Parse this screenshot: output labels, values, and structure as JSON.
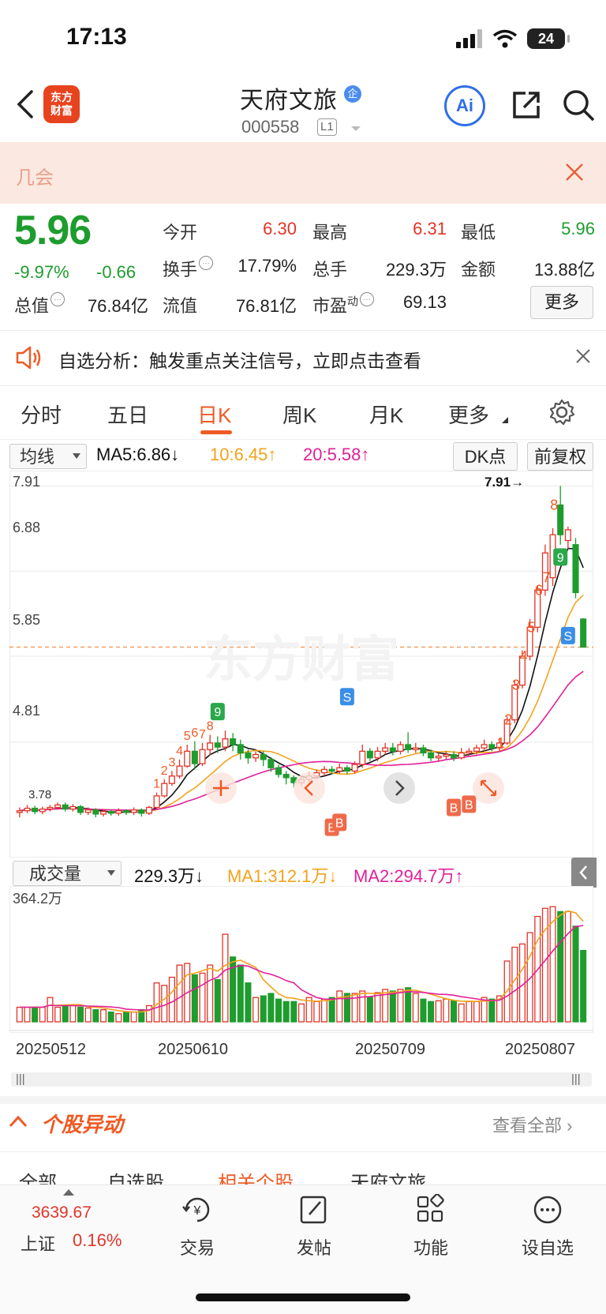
{
  "status": {
    "time": "17:13",
    "battery": "24"
  },
  "header": {
    "name": "天府文旅",
    "badge": "企",
    "code": "000558",
    "level": "L1",
    "ai": "Ai",
    "logo_line1": "东方",
    "logo_line2": "财富"
  },
  "promo": {
    "text": "几会"
  },
  "quote": {
    "price": "5.96",
    "pct": "-9.97%",
    "change": "-0.66",
    "labels": {
      "open": "今开",
      "high": "最高",
      "low": "最低",
      "turnover": "换手",
      "volume": "总手",
      "amount": "金额",
      "mcap": "总值",
      "float": "流值",
      "pe": "市盈",
      "pe_sup": "动"
    },
    "values": {
      "open": "6.30",
      "high": "6.31",
      "low": "5.96",
      "turnover": "17.79%",
      "volume": "229.3万",
      "amount": "13.88亿",
      "mcap": "76.84亿",
      "float": "76.81亿",
      "pe": "69.13"
    },
    "more": "更多"
  },
  "analysis": {
    "text": "自选分析：触发重点关注信号，立即点击查看"
  },
  "tabs": [
    "分时",
    "五日",
    "日K",
    "周K",
    "月K",
    "更多"
  ],
  "ma": {
    "select": "均线",
    "ma5": "MA5:6.86↓",
    "ma10": "10:6.45↑",
    "ma20": "20:5.58↑",
    "dk": "DK点",
    "fq": "前复权",
    "colors": {
      "ma5": "#111111",
      "ma10": "#f2a31c",
      "ma20": "#e0209a"
    }
  },
  "kline": {
    "y_labels": [
      "7.91",
      "6.88",
      "5.85",
      "4.81"
    ],
    "max_label": "7.91→",
    "min_label": "3.78",
    "watermark": "东方财富"
  },
  "volume": {
    "select": "成交量",
    "value": "229.3万↓",
    "ma1": "MA1:312.1万↓",
    "ma2": "MA2:294.7万↑",
    "max_label": "364.2万"
  },
  "dates": [
    "20250512",
    "20250610",
    "20250709",
    "20250807"
  ],
  "chart_data": {
    "type": "candlestick",
    "ylim": [
      3.7,
      8.0
    ],
    "candles": [
      [
        3.96,
        3.98,
        3.9,
        4.02
      ],
      [
        3.98,
        4.01,
        3.95,
        4.05
      ],
      [
        4.01,
        3.97,
        3.94,
        4.04
      ],
      [
        3.97,
        4.0,
        3.94,
        4.03
      ],
      [
        4.0,
        4.02,
        3.97,
        4.05
      ],
      [
        4.02,
        4.05,
        3.99,
        4.08
      ],
      [
        4.05,
        4.0,
        3.97,
        4.08
      ],
      [
        4.0,
        4.03,
        3.97,
        4.06
      ],
      [
        4.03,
        3.96,
        3.93,
        4.05
      ],
      [
        3.96,
        3.99,
        3.93,
        4.02
      ],
      [
        3.99,
        3.94,
        3.9,
        4.01
      ],
      [
        3.94,
        3.97,
        3.91,
        4.0
      ],
      [
        3.97,
        3.95,
        3.92,
        3.99
      ],
      [
        3.95,
        3.98,
        3.92,
        4.01
      ],
      [
        3.98,
        3.96,
        3.93,
        4.0
      ],
      [
        3.96,
        3.99,
        3.93,
        4.02
      ],
      [
        3.99,
        3.95,
        3.91,
        4.01
      ],
      [
        3.95,
        4.02,
        3.93,
        4.04
      ],
      [
        4.02,
        4.16,
        4.0,
        4.2
      ],
      [
        4.16,
        4.31,
        4.14,
        4.36
      ],
      [
        4.31,
        4.4,
        4.28,
        4.46
      ],
      [
        4.4,
        4.52,
        4.37,
        4.6
      ],
      [
        4.52,
        4.7,
        4.5,
        4.78
      ],
      [
        4.7,
        4.55,
        4.48,
        4.82
      ],
      [
        4.55,
        4.72,
        4.52,
        4.8
      ],
      [
        4.72,
        4.8,
        4.65,
        4.9
      ],
      [
        4.8,
        4.75,
        4.68,
        4.88
      ],
      [
        4.75,
        4.85,
        4.7,
        4.95
      ],
      [
        4.85,
        4.78,
        4.7,
        4.92
      ],
      [
        4.78,
        4.68,
        4.6,
        4.84
      ],
      [
        4.68,
        4.62,
        4.55,
        4.72
      ],
      [
        4.62,
        4.66,
        4.57,
        4.7
      ],
      [
        4.66,
        4.6,
        4.52,
        4.7
      ],
      [
        4.6,
        4.5,
        4.45,
        4.63
      ],
      [
        4.5,
        4.42,
        4.38,
        4.54
      ],
      [
        4.42,
        4.38,
        4.3,
        4.46
      ],
      [
        4.38,
        4.32,
        4.26,
        4.41
      ],
      [
        4.32,
        4.36,
        4.28,
        4.4
      ],
      [
        4.36,
        4.4,
        4.33,
        4.45
      ],
      [
        4.4,
        4.44,
        4.36,
        4.48
      ],
      [
        4.44,
        4.48,
        4.4,
        4.52
      ],
      [
        4.48,
        4.46,
        4.42,
        4.52
      ],
      [
        4.46,
        4.5,
        4.43,
        4.55
      ],
      [
        4.5,
        4.46,
        4.42,
        4.53
      ],
      [
        4.46,
        4.54,
        4.43,
        4.58
      ],
      [
        4.54,
        4.7,
        4.5,
        4.78
      ],
      [
        4.7,
        4.62,
        4.58,
        4.74
      ],
      [
        4.62,
        4.7,
        4.58,
        4.75
      ],
      [
        4.7,
        4.74,
        4.66,
        4.8
      ],
      [
        4.74,
        4.7,
        4.65,
        4.8
      ],
      [
        4.7,
        4.78,
        4.66,
        4.82
      ],
      [
        4.78,
        4.72,
        4.68,
        4.93
      ],
      [
        4.72,
        4.74,
        4.68,
        4.8
      ],
      [
        4.74,
        4.68,
        4.64,
        4.78
      ],
      [
        4.68,
        4.62,
        4.58,
        4.72
      ],
      [
        4.62,
        4.64,
        4.58,
        4.68
      ],
      [
        4.64,
        4.66,
        4.6,
        4.7
      ],
      [
        4.66,
        4.62,
        4.58,
        4.7
      ],
      [
        4.62,
        4.68,
        4.6,
        4.74
      ],
      [
        4.68,
        4.7,
        4.64,
        4.74
      ],
      [
        4.7,
        4.74,
        4.66,
        4.78
      ],
      [
        4.74,
        4.78,
        4.7,
        4.84
      ],
      [
        4.78,
        4.74,
        4.7,
        4.82
      ],
      [
        4.74,
        4.8,
        4.7,
        4.86
      ],
      [
        4.8,
        5.08,
        4.78,
        5.12
      ],
      [
        5.08,
        5.5,
        5.04,
        5.56
      ],
      [
        5.5,
        5.85,
        5.46,
        5.92
      ],
      [
        5.85,
        6.2,
        5.8,
        6.3
      ],
      [
        6.2,
        6.65,
        6.14,
        6.7
      ],
      [
        6.65,
        7.1,
        6.58,
        7.2
      ],
      [
        6.8,
        7.32,
        6.7,
        7.4
      ],
      [
        7.68,
        7.32,
        7.2,
        7.91
      ],
      [
        7.25,
        7.38,
        7.15,
        7.42
      ],
      [
        7.2,
        6.62,
        6.55,
        7.28
      ],
      [
        6.3,
        5.96,
        5.96,
        6.31
      ]
    ]
  }
}
